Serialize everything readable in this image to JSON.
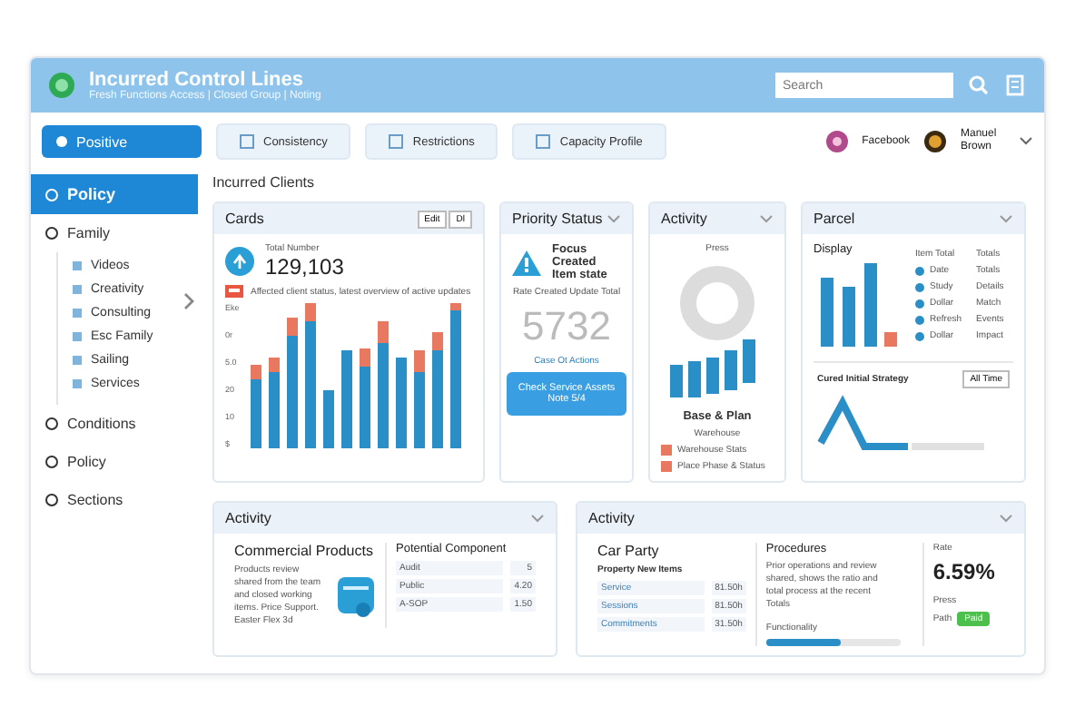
{
  "header": {
    "title": "Incurred Control Lines",
    "subtitle": "Fresh Functions  Access | Closed  Group | Noting",
    "search": {
      "placeholder": "Search"
    }
  },
  "toolbar": {
    "primary": "Positive",
    "tabs": [
      {
        "label": "Consistency",
        "selected": false
      },
      {
        "label": "Restrictions",
        "selected": false
      },
      {
        "label": "Capacity Profile",
        "selected": false
      }
    ],
    "account": "Facebook",
    "user": "Manuel Brown"
  },
  "sidebar": {
    "items": [
      {
        "label": "Policy",
        "selected": true
      },
      {
        "label": "Family",
        "selected": false,
        "expanded": true,
        "children": [
          {
            "label": "Videos"
          },
          {
            "label": "Creativity"
          },
          {
            "label": "Consulting"
          },
          {
            "label": "Esc Family"
          },
          {
            "label": "Sailing"
          },
          {
            "label": "Services"
          }
        ]
      },
      {
        "label": "Conditions",
        "selected": false
      },
      {
        "label": "Policy",
        "selected": false
      },
      {
        "label": "Sections",
        "selected": false
      }
    ]
  },
  "heading": "Incurred Clients",
  "cards": {
    "title": "Cards",
    "buttons": [
      "Edit",
      "Dl"
    ],
    "metric_label": "Total Number",
    "metric": "129,103",
    "alert": "Affected client status, latest overview of active updates",
    "y_labels": [
      "Eke",
      "0r",
      "5.0",
      "20",
      "10",
      "$"
    ]
  },
  "priority": {
    "title": "Priority Status",
    "warning": "Focus Created Item state",
    "caption": "Rate Created Update Total",
    "value": "5732",
    "link": "Case Ot Actions",
    "button": "Check Service Assets Note 5/4"
  },
  "activity": {
    "title": "Activity",
    "donut_label": "Press",
    "legend_title": "Base & Plan",
    "legend_sub": "Warehouse",
    "legend": [
      "Warehouse  Stats",
      "Place Phase & Status"
    ]
  },
  "panel": {
    "title": "Parcel",
    "chart_title": "Display",
    "col_1": "Item Total",
    "col_2": "Totals",
    "rows": [
      {
        "name": "Date",
        "value": "Totals"
      },
      {
        "name": "Study",
        "value": "Details"
      },
      {
        "name": "Dollar",
        "value": "Match"
      },
      {
        "name": "Refresh",
        "value": "Events"
      },
      {
        "name": "Dollar",
        "value": "Impact"
      }
    ],
    "sub_title": "Cured Initial Strategy",
    "sub_button": "All Time"
  },
  "activity_left": {
    "title": "Activity",
    "heading": "Commercial Products",
    "text": "Products review shared from the team and closed working items. Price Support. Easter Flex 3d",
    "table_title": "Potential Component",
    "rows": [
      {
        "name": "Audit",
        "value": "5"
      },
      {
        "name": "Public",
        "value": "4.20"
      },
      {
        "name": "A-SOP",
        "value": "1.50"
      }
    ]
  },
  "activity_right": {
    "title": "Activity",
    "heading": "Car Party",
    "subheading": "Property New Items",
    "rows": [
      {
        "name": "Service",
        "value": "81.50h"
      },
      {
        "name": "Sessions",
        "value": "81.50h"
      },
      {
        "name": "Commitments",
        "value": "31.50h"
      }
    ],
    "proc_title": "Procedures",
    "proc_text": "Prior operations and review shared, shows the ratio and total process at the recent Totals",
    "progress_label": "Functionality",
    "level": 0.55,
    "rate_label": "Rate",
    "rate": "6.59%",
    "status_label": "Press",
    "status_value": "Path",
    "badge": "Paid"
  }
}
